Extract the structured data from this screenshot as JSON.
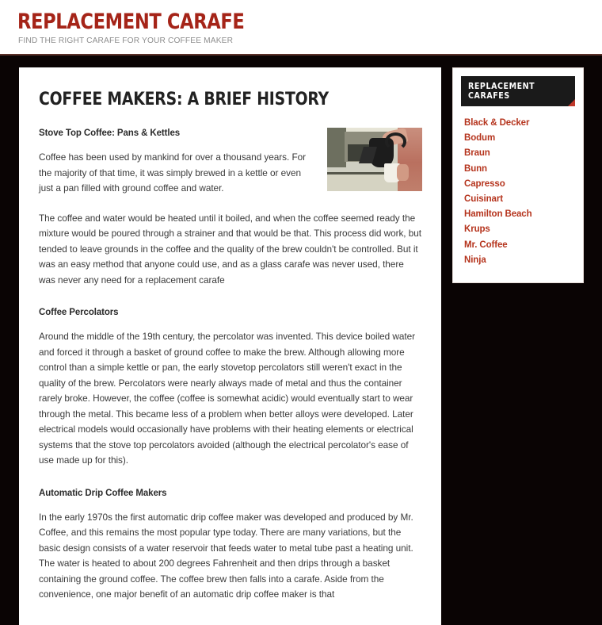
{
  "site": {
    "logo": "Replacement Carafe",
    "tagline": "Find the right carafe for your coffee maker",
    "accent_red": "#a52418",
    "link_red": "#b5341d",
    "dark_bg": "#0a0404"
  },
  "article": {
    "title": "Coffee Makers: A Brief History",
    "thumbnail_alt": "Person pouring coffee from a black carafe into a white mug",
    "sections": [
      {
        "heading": "Stove Top Coffee: Pans & Kettles",
        "paragraphs": [
          "Coffee has been used by mankind for over a thousand years. For the majority of that time, it was simply brewed in a kettle or even just a pan filled with ground coffee and water.",
          "The coffee and water would be heated until it boiled, and when the coffee seemed ready the mixture would be poured through a strainer and that would be that. This process did work, but tended to leave grounds in the coffee and the quality of the brew couldn't be controlled. But it was an easy method that anyone could use, and as a glass carafe was never used, there was never any need for a replacement carafe"
        ]
      },
      {
        "heading": "Coffee Percolators",
        "paragraphs": [
          "Around the middle of the 19th century, the percolator was invented. This device boiled water and forced it through a basket of ground coffee to make the brew. Although allowing more control than a simple kettle or pan, the early stovetop percolators still weren't exact in the quality of the brew. Percolators were nearly always made of metal and thus the container rarely broke. However, the coffee (coffee is somewhat acidic) would eventually start to wear through the metal. This became less of a problem when better alloys were developed. Later electrical models would occasionally have problems with their heating elements or electrical systems that the stove top percolators avoided (although the electrical percolator's ease of use made up for this)."
        ]
      },
      {
        "heading": "Automatic Drip Coffee Makers",
        "paragraphs": [
          "In the early 1970s the first automatic drip coffee maker was developed and produced by Mr. Coffee, and this remains the most popular type today. There are many variations, but the basic design consists of a water reservoir that feeds water to metal tube past a heating unit. The water is heated to about 200 degrees Fahrenheit and then drips through a basket containing the ground coffee. The coffee brew then falls into a carafe. Aside from the convenience, one major benefit of an automatic drip coffee maker is that"
        ]
      }
    ]
  },
  "sidebar": {
    "widget_title": "Replacement Carafes",
    "brands": [
      {
        "label": "Black & Decker"
      },
      {
        "label": "Bodum"
      },
      {
        "label": "Braun"
      },
      {
        "label": "Bunn"
      },
      {
        "label": "Capresso"
      },
      {
        "label": "Cuisinart"
      },
      {
        "label": "Hamilton Beach"
      },
      {
        "label": "Krups"
      },
      {
        "label": "Mr. Coffee"
      },
      {
        "label": "Ninja"
      }
    ]
  }
}
